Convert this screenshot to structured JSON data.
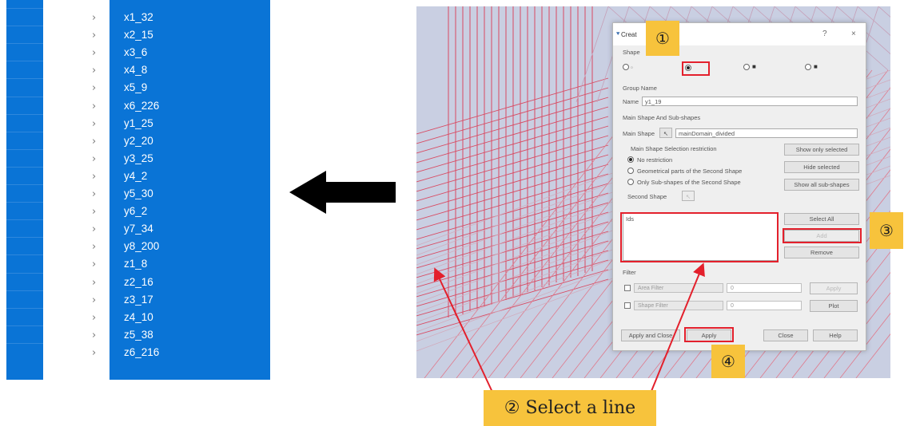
{
  "tree": {
    "items": [
      "x1_32",
      "x2_15",
      "x3_6",
      "x4_8",
      "x5_9",
      "x6_226",
      "y1_25",
      "y2_20",
      "y3_25",
      "y4_2",
      "y5_30",
      "y6_2",
      "y7_34",
      "y8_200",
      "z1_8",
      "z2_16",
      "z3_17",
      "z4_10",
      "z5_38",
      "z6_216"
    ],
    "chevron": "›",
    "selection_color": "#0a74d6"
  },
  "dialog": {
    "title": "Creat",
    "help_btn": "?",
    "close_btn": "×",
    "shape_label": "Shape",
    "group_name_label": "Group Name",
    "name_label": "Name",
    "name_value": "y1_19",
    "main_shape_section": "Main Shape And Sub-shapes",
    "main_shape_label": "Main Shape",
    "main_shape_value": "mainDomain_divided",
    "restriction_label": "Main Shape Selection restriction",
    "restrictions": [
      "No restriction",
      "Geometrical parts of the Second Shape",
      "Only Sub-shapes of the Second Shape"
    ],
    "second_shape_label": "Second Shape",
    "show_only_selected": "Show only selected",
    "hide_selected": "Hide selected",
    "show_all_subshapes": "Show all sub-shapes",
    "list_header": "Ids",
    "select_all": "Select All",
    "add": "Add",
    "remove": "Remove",
    "filter_label": "Filter",
    "filter1": "Area Filter",
    "filter2": "Shape Filter",
    "spin_value": "0",
    "apply_filter": "Apply",
    "plot": "Plot",
    "apply_and_close": "Apply and Close",
    "apply": "Apply",
    "close": "Close",
    "help": "Help"
  },
  "annotations": {
    "badge1": "①",
    "badge3": "③",
    "badge4": "④",
    "callout": "② Select a line",
    "accent_red": "#e3202c",
    "badge_color": "#f7c33c"
  },
  "icons": [
    "chevron-right-icon",
    "left-arrow-icon",
    "dialog-app-icon",
    "selection-arrow-icon"
  ]
}
